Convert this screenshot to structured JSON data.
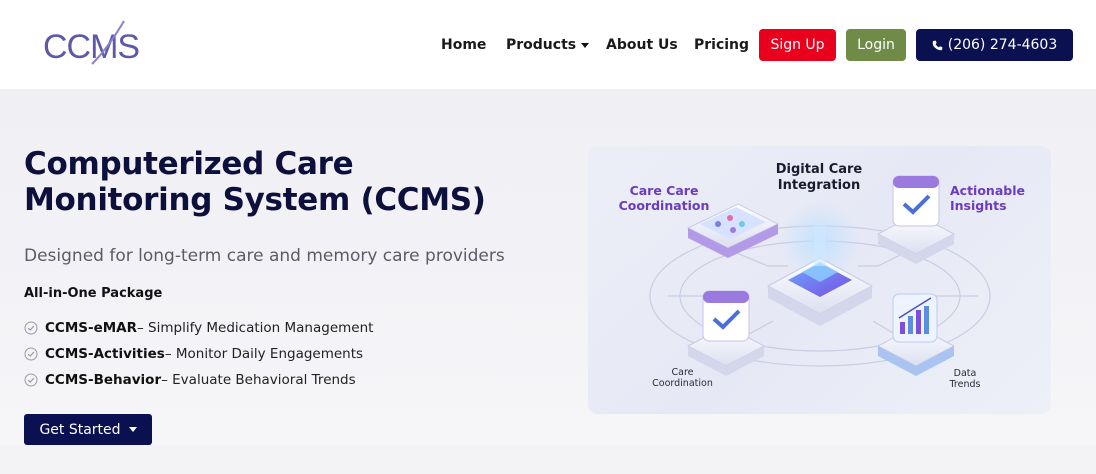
{
  "header": {
    "logo_text": "CCMS",
    "nav": [
      {
        "label": "Home"
      },
      {
        "label": "Products"
      },
      {
        "label": "About Us"
      },
      {
        "label": "Pricing"
      }
    ],
    "signup_label": "Sign Up",
    "login_label": "Login",
    "phone_label": "(206) 274-4603"
  },
  "hero": {
    "title_line1": "Computerized Care",
    "title_line2": "Monitoring System (CCMS)",
    "subtitle": "Designed for long-term care and memory care providers",
    "package_heading": "All-in-One Package",
    "features": [
      {
        "name": "CCMS-eMAR",
        "desc": " – Simplify Medication Management"
      },
      {
        "name": "CCMS-Activities",
        "desc": " – Monitor Daily Engagements"
      },
      {
        "name": "CCMS-Behavior",
        "desc": " – Evaluate Behavioral Trends"
      }
    ],
    "cta_label": "Get Started"
  },
  "illustration": {
    "label_top_center_1": "Digital Care",
    "label_top_center_2": "Integration",
    "label_top_left_1": "Care Care",
    "label_top_left_2": "Coordination",
    "label_top_right_1": "Actionable",
    "label_top_right_2": "Insights",
    "label_bottom_left_1": "Care",
    "label_bottom_left_2": "Coordination",
    "label_bottom_right_1": "Data",
    "label_bottom_right_2": "Trends"
  },
  "colors": {
    "navy": "#0b1150",
    "signup_red": "#e8001c",
    "login_green": "#6f8b47",
    "logo_purple": "#5c5aa8",
    "accent_purple": "#6d3bc2"
  },
  "icons": [
    "phone-icon",
    "check-circle-icon",
    "caret-down-icon",
    "calendar-check-icon",
    "chart-icon",
    "chip-icon"
  ]
}
